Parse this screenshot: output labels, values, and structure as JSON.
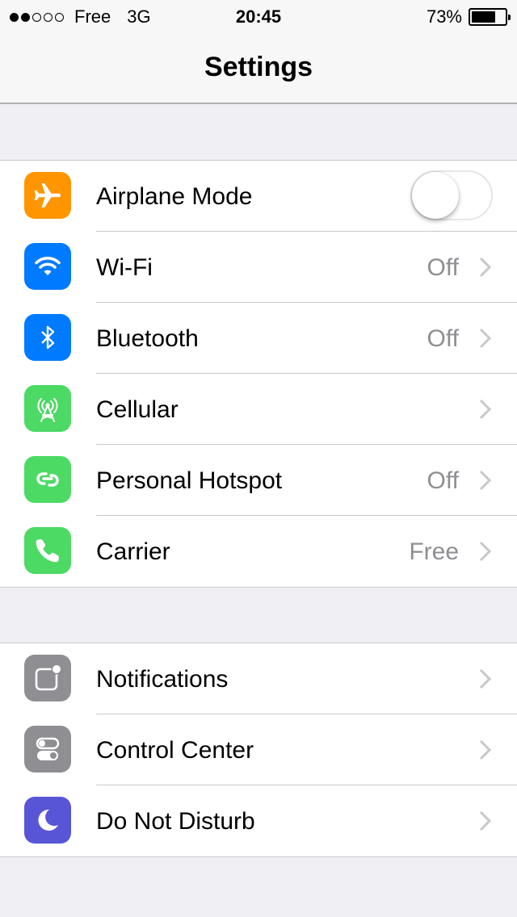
{
  "status_bar": {
    "carrier": "Free",
    "network": "3G",
    "time": "20:45",
    "battery": "73%",
    "battery_level": 0.73,
    "signal_filled": 2,
    "signal_total": 5
  },
  "nav": {
    "title": "Settings"
  },
  "colors": {
    "orange": "#ff9500",
    "blue": "#007aff",
    "green": "#4cd964",
    "gray": "#8e8e93",
    "purple": "#5856d6",
    "chevron": "#c7c7cc",
    "value_text": "#8e8e93"
  },
  "group1": {
    "airplane": {
      "label": "Airplane Mode",
      "icon": "airplane-icon",
      "toggle_on": false
    },
    "wifi": {
      "label": "Wi-Fi",
      "value": "Off",
      "icon": "wifi-icon"
    },
    "bluetooth": {
      "label": "Bluetooth",
      "value": "Off",
      "icon": "bluetooth-icon"
    },
    "cellular": {
      "label": "Cellular",
      "icon": "cellular-antenna-icon"
    },
    "hotspot": {
      "label": "Personal Hotspot",
      "value": "Off",
      "icon": "hotspot-link-icon"
    },
    "carrier": {
      "label": "Carrier",
      "value": "Free",
      "icon": "phone-icon"
    }
  },
  "group2": {
    "notifications": {
      "label": "Notifications",
      "icon": "notifications-icon"
    },
    "control_center": {
      "label": "Control Center",
      "icon": "control-center-icon"
    },
    "do_not_disturb": {
      "label": "Do Not Disturb",
      "icon": "moon-icon"
    }
  }
}
